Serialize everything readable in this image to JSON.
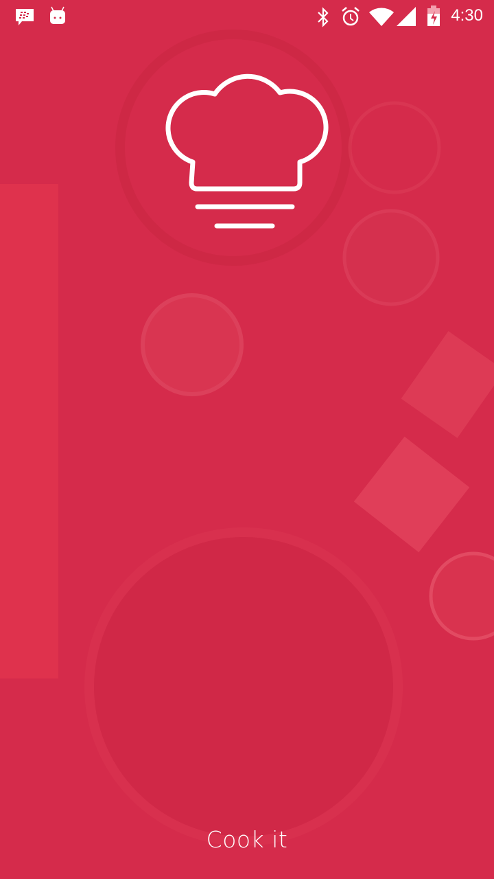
{
  "status_bar": {
    "time": "4:30",
    "icons": [
      "bbm-icon",
      "android-icon",
      "bluetooth-icon",
      "alarm-icon",
      "wifi-icon",
      "signal-icon",
      "battery-charging-icon"
    ]
  },
  "app": {
    "name": "Cook it",
    "logo": "chef-hat-icon"
  },
  "colors": {
    "background": "#d52b4b",
    "foreground": "#ffffff"
  }
}
